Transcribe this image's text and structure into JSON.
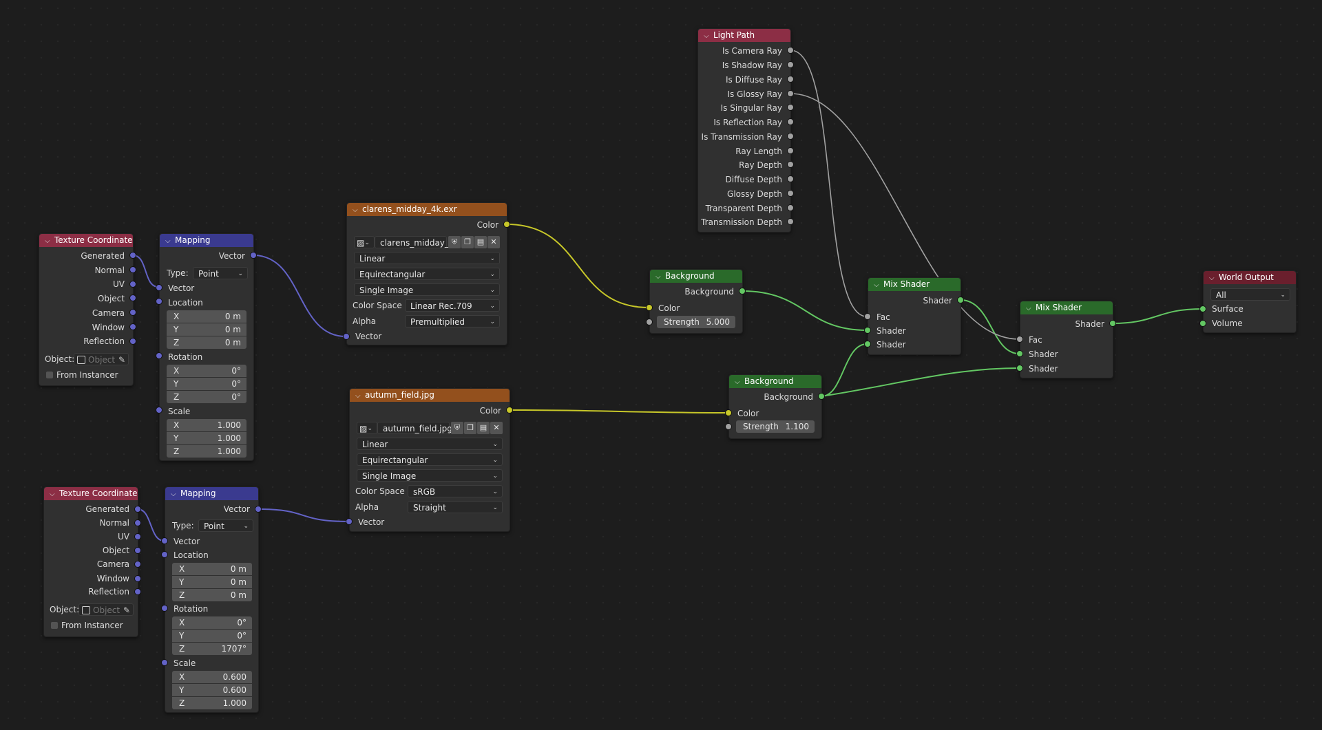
{
  "colors": {
    "canvas": "#1d1d1d",
    "input_header": "#8c2e45",
    "vector_header": "#3a3a8f",
    "image_header": "#93501d",
    "shader_header": "#2a6a2a",
    "output_header": "#6a1f2d",
    "vector_socket": "#6363c7",
    "color_socket": "#c7c729",
    "shader_socket": "#63c763",
    "float_socket": "#a1a1a1"
  },
  "texcoord1": {
    "title": "Texture Coordinate",
    "outputs": [
      "Generated",
      "Normal",
      "UV",
      "Object",
      "Camera",
      "Window",
      "Reflection"
    ],
    "object_label": "Object:",
    "object_placeholder": "Object",
    "from_instancer": "From Instancer"
  },
  "texcoord2": {
    "title": "Texture Coordinate",
    "outputs": [
      "Generated",
      "Normal",
      "UV",
      "Object",
      "Camera",
      "Window",
      "Reflection"
    ],
    "object_label": "Object:",
    "object_placeholder": "Object",
    "from_instancer": "From Instancer"
  },
  "mapping1": {
    "title": "Mapping",
    "output": "Vector",
    "type_label": "Type:",
    "type_value": "Point",
    "vector_in": "Vector",
    "location_label": "Location",
    "location": [
      {
        "k": "X",
        "v": "0 m"
      },
      {
        "k": "Y",
        "v": "0 m"
      },
      {
        "k": "Z",
        "v": "0 m"
      }
    ],
    "rotation_label": "Rotation",
    "rotation": [
      {
        "k": "X",
        "v": "0°"
      },
      {
        "k": "Y",
        "v": "0°"
      },
      {
        "k": "Z",
        "v": "0°"
      }
    ],
    "scale_label": "Scale",
    "scale": [
      {
        "k": "X",
        "v": "1.000"
      },
      {
        "k": "Y",
        "v": "1.000"
      },
      {
        "k": "Z",
        "v": "1.000"
      }
    ]
  },
  "mapping2": {
    "title": "Mapping",
    "output": "Vector",
    "type_label": "Type:",
    "type_value": "Point",
    "vector_in": "Vector",
    "location_label": "Location",
    "location": [
      {
        "k": "X",
        "v": "0 m"
      },
      {
        "k": "Y",
        "v": "0 m"
      },
      {
        "k": "Z",
        "v": "0 m"
      }
    ],
    "rotation_label": "Rotation",
    "rotation": [
      {
        "k": "X",
        "v": "0°"
      },
      {
        "k": "Y",
        "v": "0°"
      },
      {
        "k": "Z",
        "v": "1707°"
      }
    ],
    "scale_label": "Scale",
    "scale": [
      {
        "k": "X",
        "v": "0.600"
      },
      {
        "k": "Y",
        "v": "0.600"
      },
      {
        "k": "Z",
        "v": "1.000"
      }
    ]
  },
  "image1": {
    "title": "clarens_midday_4k.exr",
    "output": "Color",
    "image_name": "clarens_midday_...",
    "interpolation": "Linear",
    "projection": "Equirectangular",
    "source": "Single Image",
    "colorspace_label": "Color Space",
    "colorspace": "Linear Rec.709",
    "alpha_label": "Alpha",
    "alpha": "Premultiplied",
    "vector_in": "Vector"
  },
  "image2": {
    "title": "autumn_field.jpg",
    "output": "Color",
    "image_name": "autumn_field.jpg",
    "interpolation": "Linear",
    "projection": "Equirectangular",
    "source": "Single Image",
    "colorspace_label": "Color Space",
    "colorspace": "sRGB",
    "alpha_label": "Alpha",
    "alpha": "Straight",
    "vector_in": "Vector"
  },
  "bg1": {
    "title": "Background",
    "output": "Background",
    "color_in": "Color",
    "strength_label": "Strength",
    "strength": "5.000"
  },
  "bg2": {
    "title": "Background",
    "output": "Background",
    "color_in": "Color",
    "strength_label": "Strength",
    "strength": "1.100"
  },
  "lightpath": {
    "title": "Light Path",
    "outputs": [
      "Is Camera Ray",
      "Is Shadow Ray",
      "Is Diffuse Ray",
      "Is Glossy Ray",
      "Is Singular Ray",
      "Is Reflection Ray",
      "Is Transmission Ray",
      "Ray Length",
      "Ray Depth",
      "Diffuse Depth",
      "Glossy Depth",
      "Transparent Depth",
      "Transmission Depth"
    ]
  },
  "mix1": {
    "title": "Mix Shader",
    "output": "Shader",
    "fac": "Fac",
    "shader_a": "Shader",
    "shader_b": "Shader"
  },
  "mix2": {
    "title": "Mix Shader",
    "output": "Shader",
    "fac": "Fac",
    "shader_a": "Shader",
    "shader_b": "Shader"
  },
  "worldout": {
    "title": "World Output",
    "target": "All",
    "surface": "Surface",
    "volume": "Volume"
  }
}
